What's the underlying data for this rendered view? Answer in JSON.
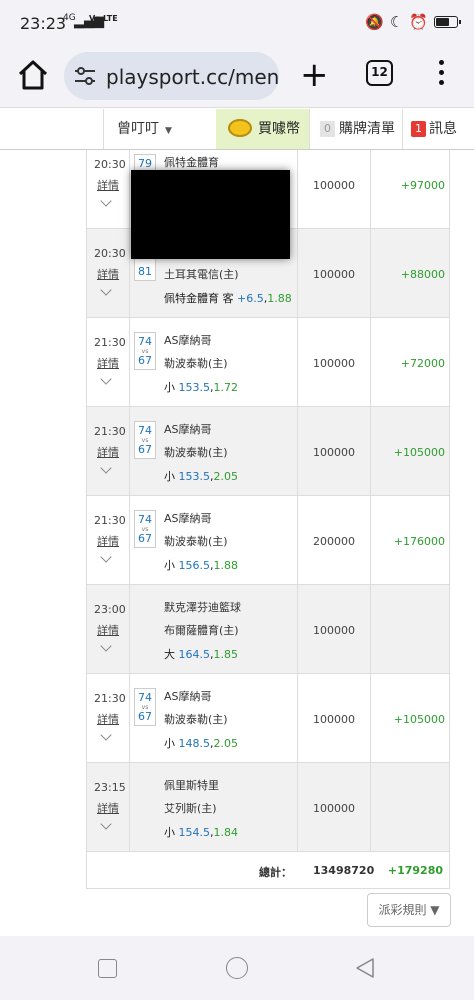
{
  "status": {
    "time": "23:23",
    "net_label": "4G",
    "volte_label": "Vo LTE",
    "battery_level": 0.6
  },
  "browser": {
    "url": "playsport.cc/men",
    "tab_count": "12"
  },
  "nav": {
    "user": "曾叮叮",
    "coin_label": "買噱幣",
    "cart_count": "0",
    "cart_label": "購牌清單",
    "msg_count": "1",
    "msg_label": "訊息"
  },
  "rows": [
    {
      "time": "20:30",
      "detail": "詳情",
      "score1": "79",
      "vs": "vs",
      "score2": "81",
      "team1": "佩特金體育",
      "team2": "",
      "bet_prefix": "",
      "bet_line": "",
      "bet_odds": "",
      "amount": "100000",
      "win": "+97000",
      "gray": false
    },
    {
      "time": "20:30",
      "detail": "詳情",
      "score1": "",
      "vs": "",
      "score2": "81",
      "team1": "",
      "team2": "土耳其電信(主)",
      "bet_prefix": "佩特金體育 客 ",
      "bet_line": "+6.5",
      "bet_odds": "1.88",
      "amount": "100000",
      "win": "+88000",
      "gray": true
    },
    {
      "time": "21:30",
      "detail": "詳情",
      "score1": "74",
      "vs": "vs",
      "score2": "67",
      "team1": "AS摩納哥",
      "team2": "勒波泰勒(主)",
      "bet_prefix": "小 ",
      "bet_line": "153.5",
      "bet_odds": "1.72",
      "amount": "100000",
      "win": "+72000",
      "gray": false
    },
    {
      "time": "21:30",
      "detail": "詳情",
      "score1": "74",
      "vs": "vs",
      "score2": "67",
      "team1": "AS摩納哥",
      "team2": "勒波泰勒(主)",
      "bet_prefix": "小 ",
      "bet_line": "153.5",
      "bet_odds": "2.05",
      "amount": "100000",
      "win": "+105000",
      "gray": true
    },
    {
      "time": "21:30",
      "detail": "詳情",
      "score1": "74",
      "vs": "vs",
      "score2": "67",
      "team1": "AS摩納哥",
      "team2": "勒波泰勒(主)",
      "bet_prefix": "小 ",
      "bet_line": "156.5",
      "bet_odds": "1.88",
      "amount": "200000",
      "win": "+176000",
      "gray": false
    },
    {
      "time": "23:00",
      "detail": "詳情",
      "score1": "",
      "vs": "",
      "score2": "",
      "team1": "默克澤芬迪籃球",
      "team2": "布爾薩體育(主)",
      "bet_prefix": "大 ",
      "bet_line": "164.5",
      "bet_odds": "1.85",
      "amount": "100000",
      "win": "",
      "gray": true
    },
    {
      "time": "21:30",
      "detail": "詳情",
      "score1": "74",
      "vs": "vs",
      "score2": "67",
      "team1": "AS摩納哥",
      "team2": "勒波泰勒(主)",
      "bet_prefix": "小 ",
      "bet_line": "148.5",
      "bet_odds": "2.05",
      "amount": "100000",
      "win": "+105000",
      "gray": false
    },
    {
      "time": "23:15",
      "detail": "詳情",
      "score1": "",
      "vs": "",
      "score2": "",
      "team1": "佩里斯特里",
      "team2": "艾列斯(主)",
      "bet_prefix": "小 ",
      "bet_line": "154.5",
      "bet_odds": "1.84",
      "amount": "100000",
      "win": "",
      "gray": true
    }
  ],
  "total": {
    "label": "總計：",
    "amount": "13498720",
    "win": "+179280"
  },
  "rules_button": "派彩規則 ▼"
}
